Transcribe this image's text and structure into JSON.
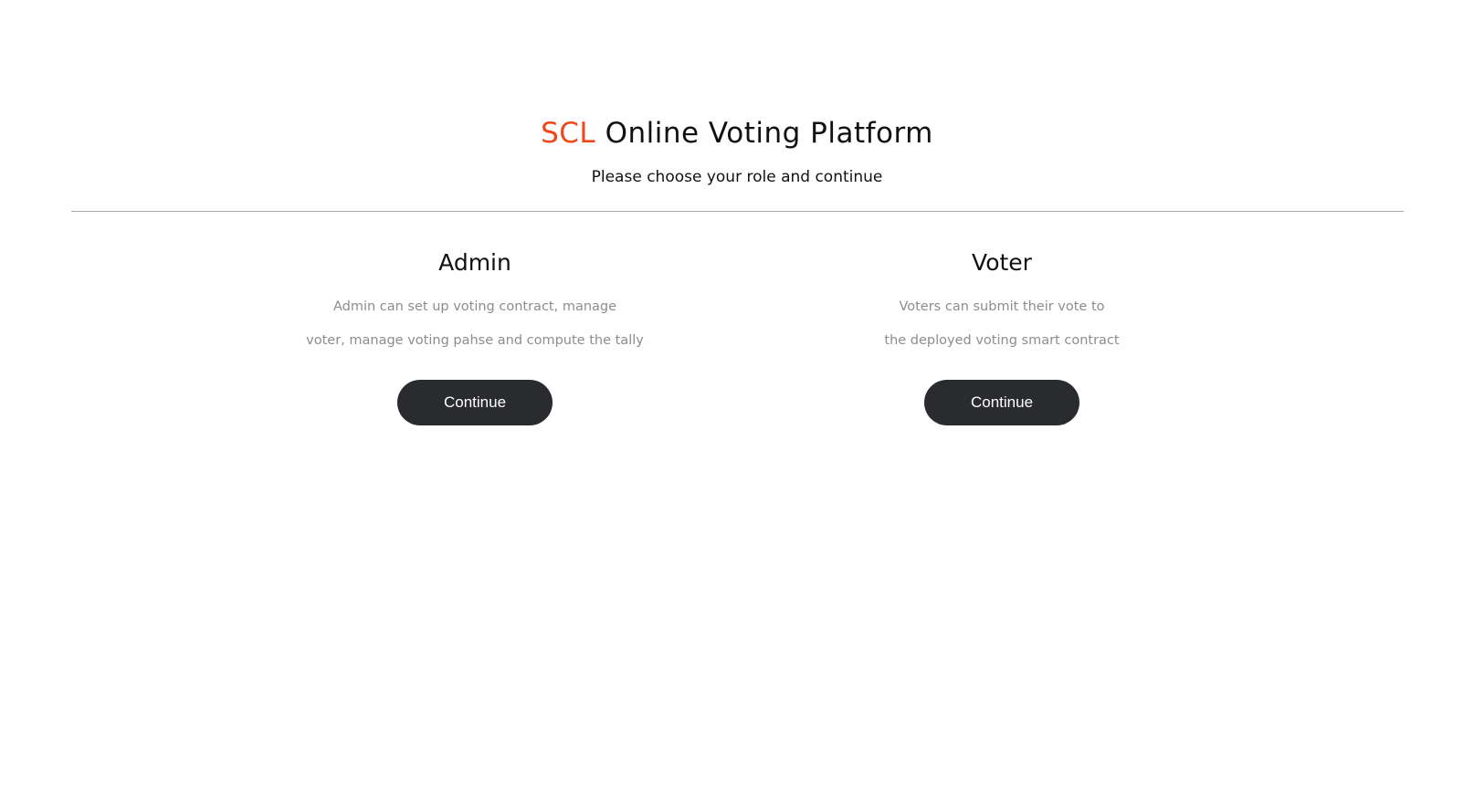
{
  "header": {
    "brand": "SCL",
    "title_rest": "Online Voting Platform",
    "subtitle": "Please choose your role and continue"
  },
  "roles": [
    {
      "title": "Admin",
      "description_lines": [
        "Admin can set up voting contract, manage",
        "voter, manage voting pahse and compute the tally"
      ],
      "button_label": "Continue"
    },
    {
      "title": "Voter",
      "description_lines": [
        "Voters can submit their vote to",
        "the deployed voting smart contract"
      ],
      "button_label": "Continue"
    }
  ],
  "colors": {
    "brand": "#f0461a",
    "button_bg": "#2a2b2f",
    "description_text": "#8d8d8d"
  }
}
